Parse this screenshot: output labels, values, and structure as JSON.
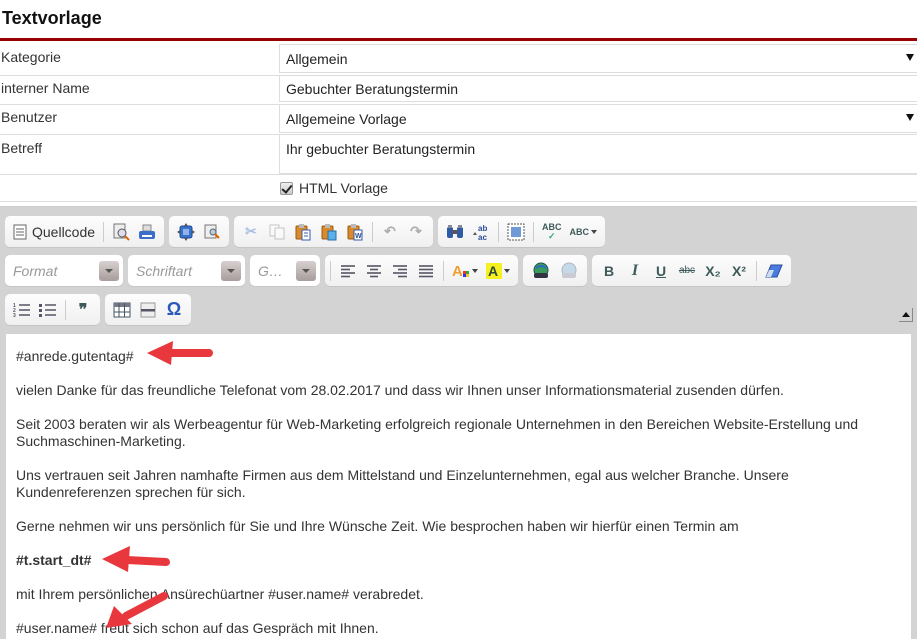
{
  "page": {
    "title": "Textvorlage",
    "accent_color": "#990000"
  },
  "form": {
    "kategorie": {
      "label": "Kategorie",
      "value": "Allgemein"
    },
    "interner_name": {
      "label": "interner Name",
      "value": "Gebuchter Beratungstermin"
    },
    "benutzer": {
      "label": "Benutzer",
      "value": "Allgemeine Vorlage"
    },
    "betreff": {
      "label": "Betreff",
      "value": "Ihr gebuchter Beratungstermin"
    },
    "html_vorlage": {
      "label": "HTML Vorlage",
      "checked": true
    }
  },
  "toolbar": {
    "source_label": "Quellcode",
    "format_placeholder": "Format",
    "font_placeholder": "Schriftart",
    "size_placeholder": "G…",
    "icons": {
      "source": "source-code-icon",
      "preview": "preview-icon",
      "print": "print-icon",
      "maximize": "maximize-icon",
      "show_blocks": "show-blocks-icon",
      "cut": "cut-icon",
      "copy": "copy-icon",
      "paste": "paste-icon",
      "paste_text": "paste-text-icon",
      "paste_word": "paste-word-icon",
      "undo": "undo-icon",
      "redo": "redo-icon",
      "find": "find-icon",
      "replace": "replace-icon",
      "select_all": "select-all-icon",
      "spellcheck": "spellcheck-icon",
      "spellcheck_menu": "spellcheck-as-you-type-icon",
      "align_left": "align-left-icon",
      "align_center": "align-center-icon",
      "align_right": "align-right-icon",
      "justify": "justify-icon",
      "text_color": "text-color-icon",
      "bg_color": "background-color-icon",
      "link": "link-icon",
      "unlink": "unlink-icon",
      "bold": "bold-icon",
      "italic": "italic-icon",
      "underline": "underline-icon",
      "strike": "strikethrough-icon",
      "subscript": "subscript-icon",
      "superscript": "superscript-icon",
      "remove_format": "remove-format-icon",
      "numbered_list": "numbered-list-icon",
      "bulleted_list": "bulleted-list-icon",
      "blockquote": "blockquote-icon",
      "table": "table-icon",
      "hr": "horizontal-line-icon",
      "special_char": "special-character-icon"
    },
    "glyphs": {
      "bold": "B",
      "italic": "I",
      "underline": "U",
      "strike": "abc",
      "sub": "X₂",
      "sup": "X²",
      "omega": "Ω",
      "quote": "❞",
      "abc": "ABC"
    }
  },
  "editor": {
    "paragraphs": [
      {
        "text": "#anrede.gutentag#",
        "bold": false
      },
      {
        "text": "vielen Danke für das freundliche Telefonat vom 28.02.2017 und dass wir Ihnen unser Informationsmaterial zusenden dürfen.",
        "bold": false
      },
      {
        "text": "Seit 2003 beraten wir als Werbeagentur für Web-Marketing erfolgreich regionale Unternehmen in den Bereichen Website-Erstellung und Suchmaschinen-Marketing.",
        "bold": false
      },
      {
        "text": "Uns vertrauen seit Jahren namhafte Firmen aus dem Mittelstand und Einzelunternehmen, egal aus welcher Branche. Unsere Kundenreferenzen sprechen für sich.",
        "bold": false
      },
      {
        "text": "Gerne nehmen wir uns persönlich für Sie und Ihre Wünsche Zeit. Wie besprochen haben wir hierfür einen Termin am",
        "bold": false
      },
      {
        "text": "#t.start_dt#",
        "bold": true
      },
      {
        "text": "mit Ihrem persönlichen Ansürechüartner #user.name# verabredet.",
        "bold": false
      },
      {
        "text": "#user.name# freut sich schon auf das Gespräch mit Ihnen.",
        "bold": false
      }
    ],
    "annotation_color": "#e8383d"
  }
}
